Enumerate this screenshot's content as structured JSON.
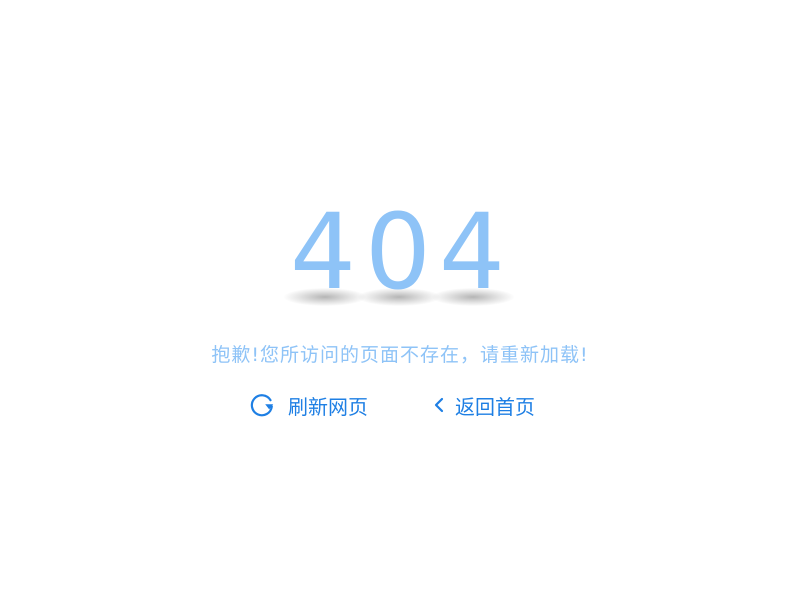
{
  "error": {
    "digits": [
      "4",
      "0",
      "4"
    ]
  },
  "message": "抱歉!您所访问的页面不存在，请重新加载!",
  "actions": {
    "refresh": {
      "label": "刷新网页",
      "icon": "refresh-icon"
    },
    "home": {
      "label": "返回首页",
      "icon": "chevron-left-icon"
    }
  },
  "colors": {
    "code": "#8ec3f7",
    "message": "#8ec3f7",
    "action": "#1e7fe4"
  }
}
